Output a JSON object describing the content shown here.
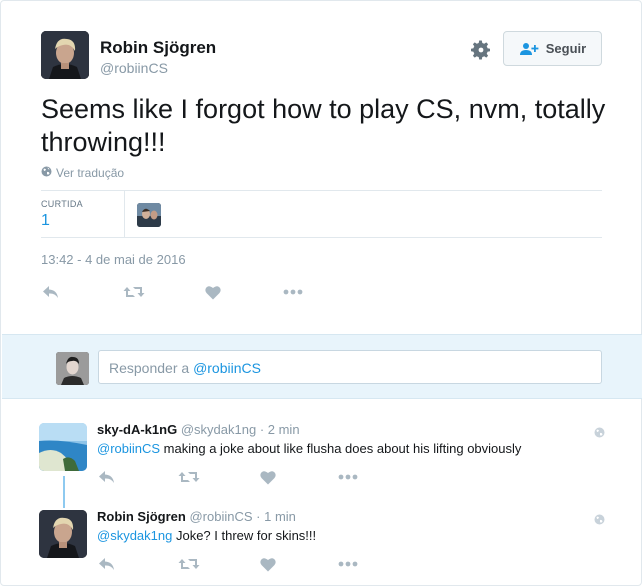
{
  "tweet": {
    "author_name": "Robin Sjögren",
    "author_handle": "@robiinCS",
    "follow_label": "Seguir",
    "text": "Seems like I forgot how to play CS, nvm, totally throwing!!!",
    "translate_label": "Ver tradução",
    "stats": {
      "likes_label": "CURTIDA",
      "likes_count": "1"
    },
    "timestamp": "13:42 - 4 de mai de 2016"
  },
  "reply_box": {
    "prefix": "Responder a ",
    "mention": "@robiinCS"
  },
  "replies": [
    {
      "name": "sky-dA-k1nG",
      "handle": "@skydak1ng",
      "time": "· 2 min",
      "mention": "@robiinCS",
      "text": " making a joke about like flusha does about his lifting obviously"
    },
    {
      "name": "Robin Sjögren",
      "handle": "@robiinCS",
      "time": "· 1 min",
      "mention": "@skydak1ng",
      "text": " Joke? I threw for skins!!!"
    }
  ],
  "icons": {
    "gear": "gear-icon",
    "follow": "add-user-icon",
    "globe": "globe-icon",
    "reply": "reply-icon",
    "retweet": "retweet-icon",
    "like": "heart-icon",
    "more": "more-icon"
  },
  "colors": {
    "accent": "#1b95e0",
    "muted": "#8899a6",
    "action_icon": "#aab8c2",
    "reply_bg": "#e8f4fb"
  }
}
